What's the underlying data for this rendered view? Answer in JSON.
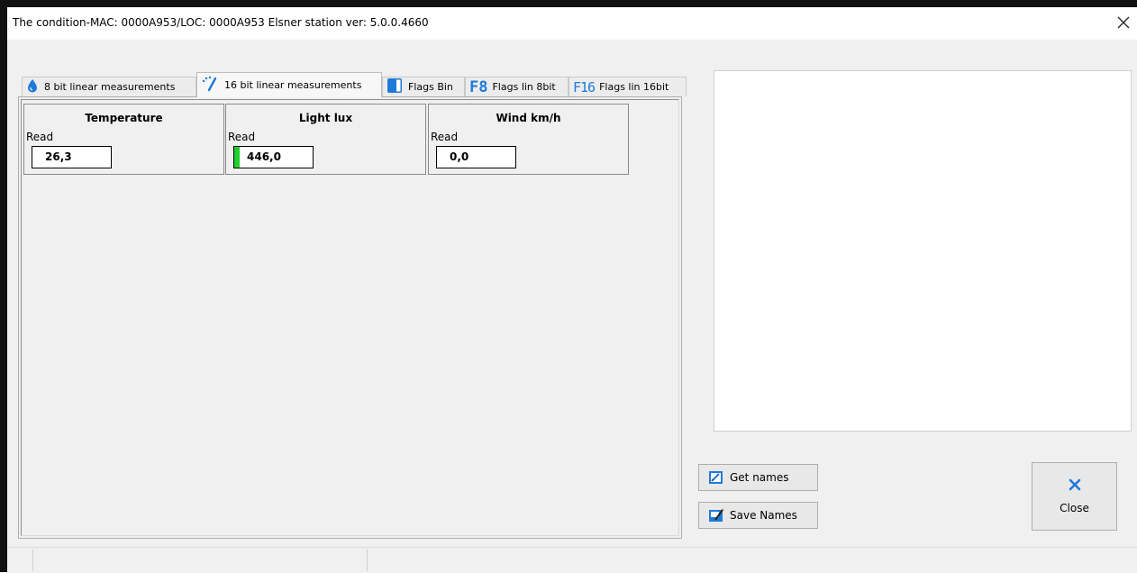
{
  "window": {
    "title": "The condition-MAC: 0000A953/LOC: 0000A953 Elsner station ver: 5.0.0.4660"
  },
  "tabs": [
    {
      "label": "8 bit linear measurements",
      "icon": "drop-icon"
    },
    {
      "label": "16 bit linear measurements",
      "icon": "gauge-needle-icon",
      "active": true
    },
    {
      "label": "Flags Bin",
      "icon": "half-square-icon"
    },
    {
      "label": "Flags lin 8bit",
      "icon": "F8-icon",
      "icon_text": "F8"
    },
    {
      "label": "Flags lin 16bit",
      "icon": "F16-icon",
      "icon_text": "F16"
    }
  ],
  "measurements": [
    {
      "title": "Temperature",
      "read_label": "Read",
      "value": "26,3",
      "level": 0
    },
    {
      "title": "Light lux",
      "read_label": "Read",
      "value": "446,0",
      "level": 0.07
    },
    {
      "title": "Wind km/h",
      "read_label": "Read",
      "value": "0,0",
      "level": 0
    }
  ],
  "buttons": {
    "get_names": "Get names",
    "save_names": "Save Names",
    "close": "Close"
  },
  "colors": {
    "accent_blue": "#1e7ad9",
    "level_green": "#1fd12b"
  }
}
